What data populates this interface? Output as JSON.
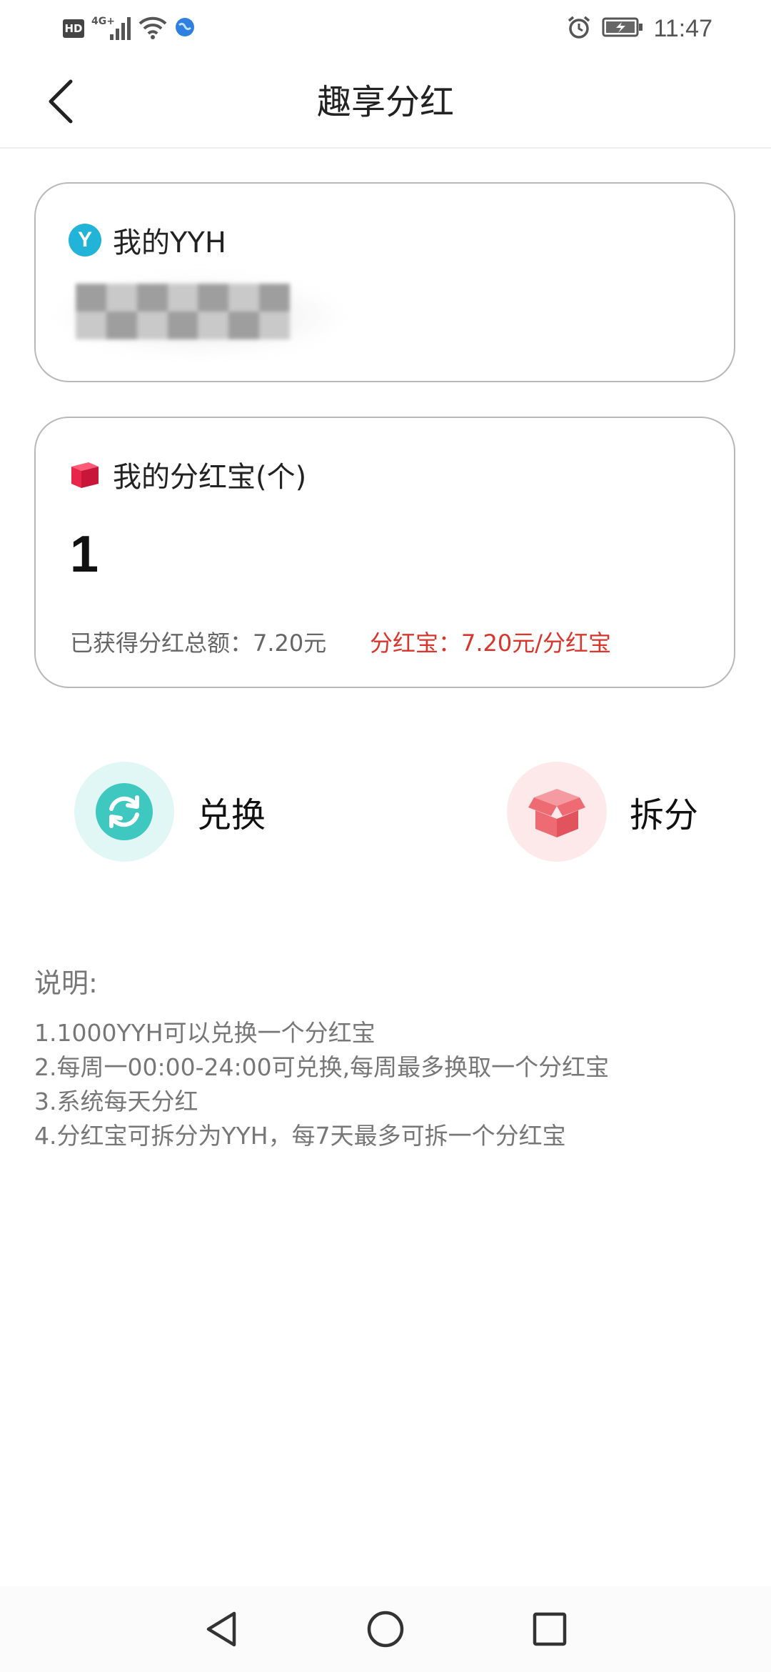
{
  "status_bar": {
    "hd_label": "HD",
    "network_label": "4G+",
    "time": "11:47",
    "icons": [
      "hd-icon",
      "signal-icon",
      "wifi-icon",
      "browser-icon",
      "alarm-icon",
      "battery-icon"
    ]
  },
  "header": {
    "title": "趣享分红",
    "back_icon": "back-icon"
  },
  "yyh_card": {
    "label": "我的YYH",
    "icon_letter": "Y",
    "icon_color": "#22b4d8"
  },
  "box_card": {
    "label": "我的分红宝(个)",
    "count": "1",
    "total_earned": "已获得分红总额：7.20元",
    "rate": "分红宝：7.20元/分红宝",
    "icon_color": "#e8264a",
    "rate_color": "#d8362c"
  },
  "actions": {
    "exchange_label": "兑换",
    "split_label": "拆分",
    "exchange_color": "#3ec8c0",
    "split_color": "#ef6b73"
  },
  "notes": {
    "title": "说明:",
    "lines": [
      "1.1000YYH可以兑换一个分红宝",
      "2.每周一00:00-24:00可兑换,每周最多换取一个分红宝",
      "3.系统每天分红",
      "4.分红宝可拆分为YYH，每7天最多可拆一个分红宝"
    ]
  },
  "nav_bar": {
    "icons": [
      "nav-back-icon",
      "nav-home-icon",
      "nav-recent-icon"
    ]
  }
}
